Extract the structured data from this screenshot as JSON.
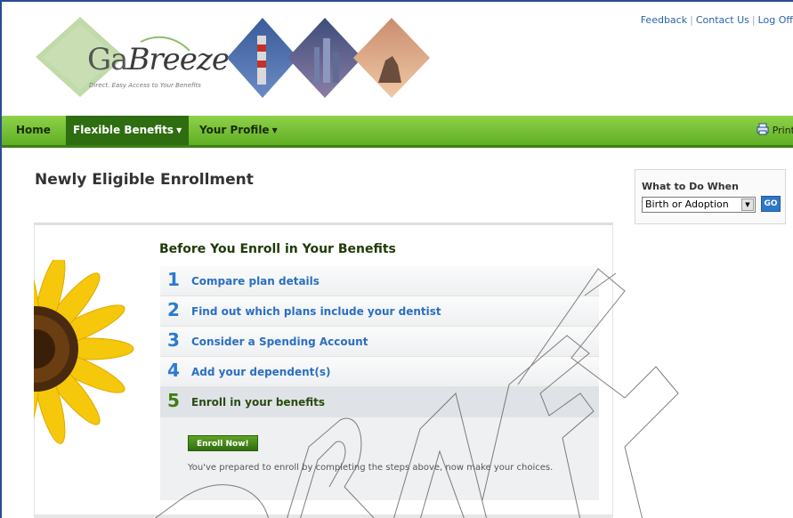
{
  "header": {
    "links": [
      "Feedback",
      "Contact Us",
      "Log Off"
    ],
    "logo": {
      "brand": "GaBreeze",
      "tagline": "Direct. Easy Access to Your Benefits"
    }
  },
  "nav": {
    "items": [
      {
        "label": "Home",
        "active": false,
        "dropdown": false
      },
      {
        "label": "Flexible Benefits",
        "active": true,
        "dropdown": true
      },
      {
        "label": "Your Profile",
        "active": false,
        "dropdown": true
      }
    ],
    "print_label": "Print"
  },
  "main": {
    "title": "Newly Eligible Enrollment",
    "panel_heading": "Before You Enroll in Your Benefits",
    "steps": [
      {
        "number": "1",
        "label": "Compare plan details"
      },
      {
        "number": "2",
        "label": "Find out which plans include your dentist"
      },
      {
        "number": "3",
        "label": "Consider a Spending Account"
      },
      {
        "number": "4",
        "label": "Add your dependent(s)"
      },
      {
        "number": "5",
        "label": "Enroll in your benefits"
      }
    ],
    "enroll_button": "Enroll Now!",
    "enroll_text": "You've prepared to enroll by completing the steps above, now make your choices."
  },
  "sidebar": {
    "title": "What to Do When",
    "select_value": "Birth or Adoption",
    "go_label": "GO"
  },
  "colors": {
    "nav_green": "#5fae24",
    "nav_active": "#2e6d10",
    "link_blue": "#2b6fc2",
    "current_step_green": "#3f7d12"
  }
}
